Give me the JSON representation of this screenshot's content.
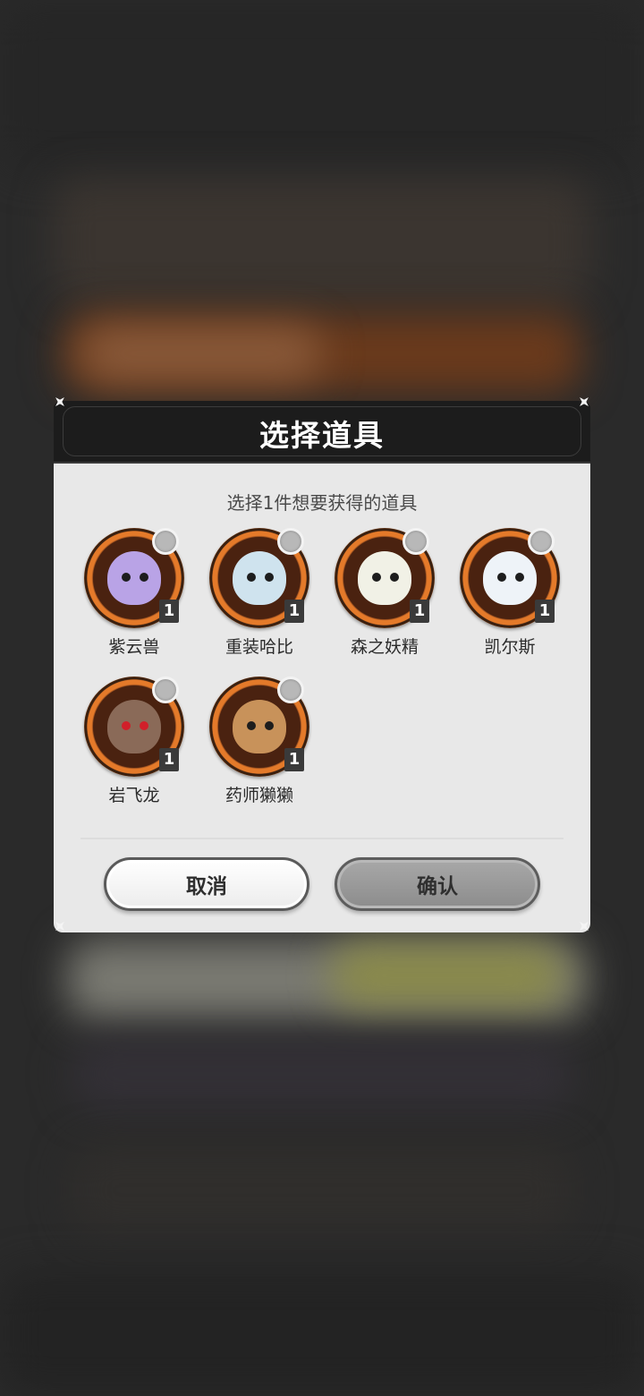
{
  "dialog": {
    "title": "选择道具",
    "subtitle": "选择1件想要获得的道具",
    "items": [
      {
        "name": "紫云兽",
        "count": "1",
        "color": "#b9a3e6",
        "selected": false
      },
      {
        "name": "重装哈比",
        "count": "1",
        "color": "#cfe3ee",
        "selected": false
      },
      {
        "name": "森之妖精",
        "count": "1",
        "color": "#f1f1e6",
        "selected": false
      },
      {
        "name": "凯尔斯",
        "count": "1",
        "color": "#eef3f8",
        "selected": false
      },
      {
        "name": "岩飞龙",
        "count": "1",
        "color": "#8a6a58",
        "selected": false
      },
      {
        "name": "药师獭獭",
        "count": "1",
        "color": "#c8925a",
        "selected": false
      }
    ],
    "cancel_label": "取消",
    "confirm_label": "确认"
  }
}
